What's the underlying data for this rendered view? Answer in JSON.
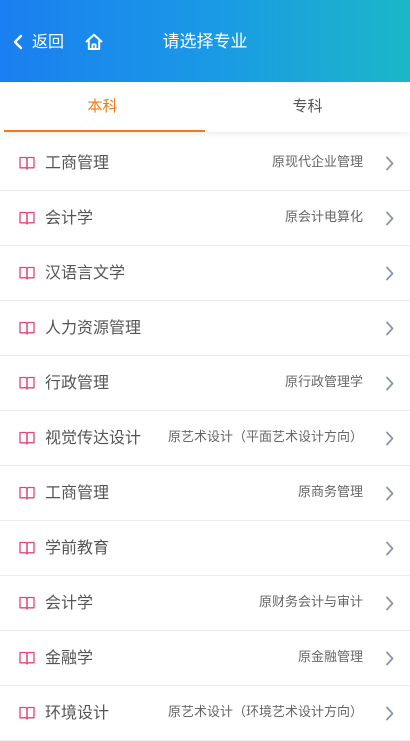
{
  "header": {
    "back_label": "返回",
    "title": "请选择专业",
    "gradient_start": "#1a7ff0",
    "gradient_end": "#1bb7c8"
  },
  "tabs": [
    {
      "label": "本科",
      "active": true
    },
    {
      "label": "专科",
      "active": false
    }
  ],
  "colors": {
    "accent": "#f07a1a",
    "book_icon": "#e2457a",
    "chevron": "#8a96a3"
  },
  "majors": [
    {
      "name": "工商管理",
      "former": "原现代企业管理"
    },
    {
      "name": "会计学",
      "former": "原会计电算化"
    },
    {
      "name": "汉语言文学",
      "former": ""
    },
    {
      "name": "人力资源管理",
      "former": ""
    },
    {
      "name": "行政管理",
      "former": "原行政管理学"
    },
    {
      "name": "视觉传达设计",
      "former": "原艺术设计（平面艺术设计方向）"
    },
    {
      "name": "工商管理",
      "former": "原商务管理"
    },
    {
      "name": "学前教育",
      "former": ""
    },
    {
      "name": "会计学",
      "former": "原财务会计与审计"
    },
    {
      "name": "金融学",
      "former": "原金融管理"
    },
    {
      "name": "环境设计",
      "former": "原艺术设计（环境艺术设计方向）"
    }
  ],
  "icons": {
    "back": "chevron-left-icon",
    "home": "home-icon",
    "item": "book-icon",
    "item_arrow": "chevron-right-icon"
  }
}
